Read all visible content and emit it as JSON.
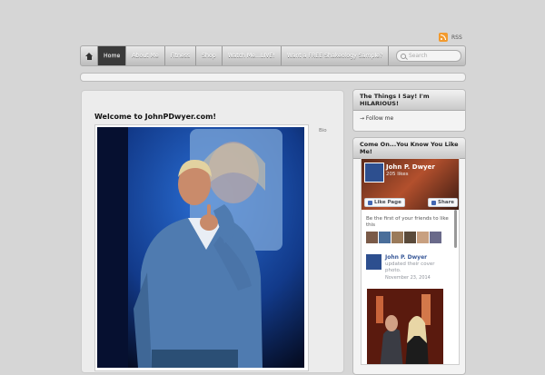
{
  "header": {
    "rss_label": "RSS"
  },
  "nav": {
    "items": [
      {
        "label": "Home",
        "active": true
      },
      {
        "label": "About Me",
        "active": false
      },
      {
        "label": "Fitness",
        "active": false
      },
      {
        "label": "Shop",
        "active": false
      },
      {
        "label": "Watch Me...LIVE!",
        "active": false
      },
      {
        "label": "Want a FREE Shakeology Sample?",
        "active": false
      }
    ],
    "search_placeholder": "Search"
  },
  "main": {
    "title": "Welcome to JohnPDwyer.com!",
    "side_label": "Bio"
  },
  "sidebar": {
    "widget1": {
      "title": "The Things I Say! I'm HILARIOUS!",
      "follow_label": "→ Follow me"
    },
    "widget2": {
      "title": "Come On...You Know You Like Me!"
    }
  },
  "facebook": {
    "page_name": "John P. Dwyer",
    "likes": "205 likes",
    "like_button": "Like Page",
    "share_button": "Share",
    "friends_text": "Be the first of your friends to like this",
    "post": {
      "author": "John P. Dwyer",
      "text": "updated their cover photo.",
      "date": "November 23, 2014"
    }
  },
  "colors": {
    "nav_active": "#3a3a3a",
    "facebook_blue": "#385898",
    "rss_orange": "#f29a2e"
  }
}
